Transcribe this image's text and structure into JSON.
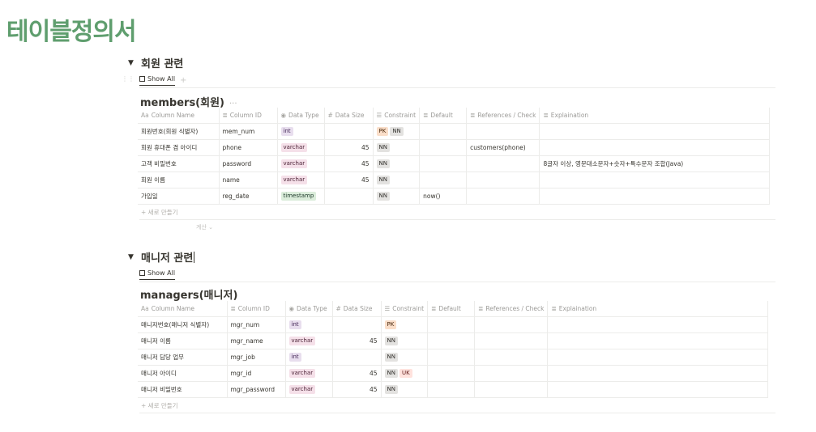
{
  "page": {
    "title": "테이블정의서"
  },
  "sections": [
    {
      "toggle": "회원 관련",
      "view_tab": "Show All",
      "db_title": "members(회원)",
      "db_more": "···",
      "columns": [
        "Column Name",
        "Column ID",
        "Data Type",
        "Data Size",
        "Constraint",
        "Default",
        "References / Check",
        "Explaination"
      ],
      "column_icons": [
        "Aa",
        "≣",
        "◉",
        "#",
        "☰",
        "≣",
        "≣",
        "≣"
      ],
      "rows": [
        {
          "name": "회원번호(회원 식별자)",
          "id": "mem_num",
          "type": "int",
          "size": "",
          "constraints": [
            "PK",
            "NN"
          ],
          "default": "",
          "refs": "",
          "explain": ""
        },
        {
          "name": "회원 휴대폰 겸 아이디",
          "id": "phone",
          "type": "varchar",
          "size": "45",
          "constraints": [
            "NN"
          ],
          "default": "",
          "refs": "customers(phone)",
          "explain": ""
        },
        {
          "name": "고객 비밀번호",
          "id": "password",
          "type": "varchar",
          "size": "45",
          "constraints": [
            "NN"
          ],
          "default": "",
          "refs": "",
          "explain": "8글자 이상, 영문대소문자+숫자+특수문자 조합(Java)"
        },
        {
          "name": "회원 이름",
          "id": "name",
          "type": "varchar",
          "size": "45",
          "constraints": [
            "NN"
          ],
          "default": "",
          "refs": "",
          "explain": ""
        },
        {
          "name": "가입일",
          "id": "reg_date",
          "type": "timestamp",
          "size": "",
          "constraints": [
            "NN"
          ],
          "default": "now()",
          "refs": "",
          "explain": ""
        }
      ],
      "new_row": "+ 새로 만들기",
      "calc": "계산 ⌄"
    },
    {
      "toggle": "매니저 관련",
      "view_tab": "Show All",
      "db_title": "managers(매니저)",
      "columns": [
        "Column Name",
        "Column ID",
        "Data Type",
        "Data Size",
        "Constraint",
        "Default",
        "References / Check",
        "Explaination"
      ],
      "column_icons": [
        "Aa",
        "≣",
        "◉",
        "#",
        "☰",
        "≣",
        "≣",
        "≣"
      ],
      "rows": [
        {
          "name": "매니저번호(매니저 식별자)",
          "id": "mgr_num",
          "type": "int",
          "size": "",
          "constraints": [
            "PK"
          ],
          "default": "",
          "refs": "",
          "explain": ""
        },
        {
          "name": "매니저 이름",
          "id": "mgr_name",
          "type": "varchar",
          "size": "45",
          "constraints": [
            "NN"
          ],
          "default": "",
          "refs": "",
          "explain": ""
        },
        {
          "name": "매니저 담당 업무",
          "id": "mgr_job",
          "type": "int",
          "size": "",
          "constraints": [
            "NN"
          ],
          "default": "",
          "refs": "",
          "explain": ""
        },
        {
          "name": "매니저 아이디",
          "id": "mgr_id",
          "type": "varchar",
          "size": "45",
          "constraints": [
            "NN",
            "UK"
          ],
          "default": "",
          "refs": "",
          "explain": ""
        },
        {
          "name": "매니저 비밀번호",
          "id": "mgr_password",
          "type": "varchar",
          "size": "45",
          "constraints": [
            "NN"
          ],
          "default": "",
          "refs": "",
          "explain": ""
        }
      ],
      "new_row": "+ 새로 만들기"
    }
  ],
  "tag_colors": {
    "int": "tag-purple",
    "varchar": "tag-pink",
    "timestamp": "tag-green",
    "PK": "tag-orange",
    "NN": "tag-gray",
    "UK": "tag-red"
  }
}
